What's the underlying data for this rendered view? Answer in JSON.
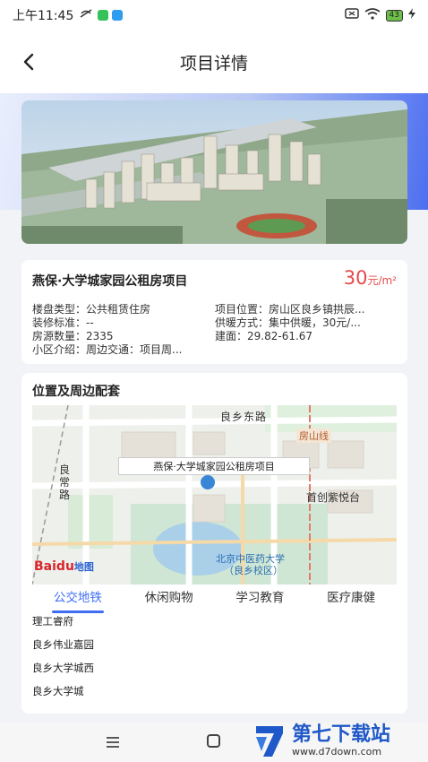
{
  "status_bar": {
    "time": "上午11:45",
    "battery": "43"
  },
  "header": {
    "title": "项目详情"
  },
  "project": {
    "name": "燕保·大学城家园公租房项目",
    "price_value": "30",
    "price_unit": "元/m²",
    "details": [
      {
        "label": "楼盘类型：",
        "value": "公共租赁住房"
      },
      {
        "label": "项目位置：",
        "value": "房山区良乡镇拱辰..."
      },
      {
        "label": "装修标准：",
        "value": "--"
      },
      {
        "label": "供暖方式：",
        "value": "集中供暖，30元/..."
      },
      {
        "label": "房源数量：",
        "value": "2335"
      },
      {
        "label": "建面：",
        "value": "29.82-61.67"
      },
      {
        "label": "小区介绍：",
        "value": "周边交通：项目周..."
      }
    ]
  },
  "location": {
    "title": "位置及周边配套",
    "map": {
      "popup": "燕保·大学城家园公租房项目",
      "labels": {
        "road_north": "良乡东路",
        "railway": "房山线",
        "road_west": "良\n常\n路",
        "community": "首创紫悦台",
        "university": "北京中医药大学",
        "university_sub": "（良乡校区）",
        "logo_baidu": "Baidu",
        "logo_map": "地图"
      }
    },
    "tabs": [
      {
        "label": "公交地铁",
        "active": true
      },
      {
        "label": "休闲购物",
        "active": false
      },
      {
        "label": "学习教育",
        "active": false
      },
      {
        "label": "医疗康健",
        "active": false
      }
    ],
    "pois": [
      "理工睿府",
      "良乡伟业嘉园",
      "良乡大学城西",
      "良乡大学城"
    ]
  },
  "watermark": {
    "title": "第七下载站",
    "url": "www.d7down.com"
  },
  "colors": {
    "accent": "#3f6ef3",
    "price": "#e64a4a"
  }
}
